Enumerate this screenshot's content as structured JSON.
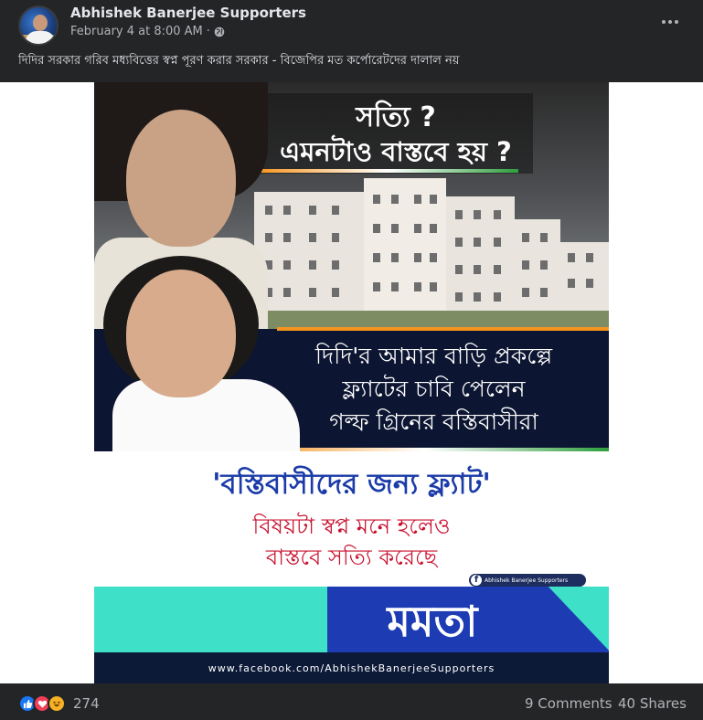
{
  "post": {
    "page_name": "Abhishek Banerjee Supporters",
    "timestamp": "February 4 at 8:00 AM",
    "separator": "·",
    "privacy_icon": "globe-icon",
    "caption": "দিদির সরকার গরিব মধ্যবিত্তের স্বপ্ন পূরণ করার সরকার - বিজেপির মত কর্পোরেটদের দালাল নয়"
  },
  "poster": {
    "question_line1": "সত্যি ?",
    "question_line2": "এমনটাও বাস্তবে হয় ?",
    "mid_line1": "দিদি'র আমার বাড়ি প্রকল্পে",
    "mid_line2": "ফ্ল্যাটের চাবি পেলেন",
    "mid_line3": "গল্ফ গ্রিনের বস্তিবাসীরা",
    "quote_line": "'বস্তিবাসীদের জন্য ফ্ল্যাট'",
    "line_dream": "বিষয়টা স্বপ্ন মনে হলেও",
    "line_true": "বাস্তবে সত্যি করেছে",
    "badge_text": "Abhishek Banerjee Supporters",
    "badge_icon": "facebook-f-icon",
    "name_banner": "মমতা",
    "url": "www.facebook.com/AbhishekBanerjeeSupporters",
    "colors": {
      "navy": "#0c1531",
      "blue_text": "#1b3ca8",
      "red_text": "#c8102e",
      "teal": "#3fe0c8",
      "royal_blue": "#1d3bb3",
      "saffron": "#f7941d",
      "green": "#2e9e3d"
    }
  },
  "footer": {
    "reaction_icons": [
      "like-icon",
      "love-icon",
      "haha-icon"
    ],
    "reaction_count": "274",
    "comments": "9 Comments",
    "shares": "40 Shares"
  },
  "theme": {
    "background": "#242526",
    "primary_text": "#e4e6eb",
    "secondary_text": "#b0b3b8"
  }
}
